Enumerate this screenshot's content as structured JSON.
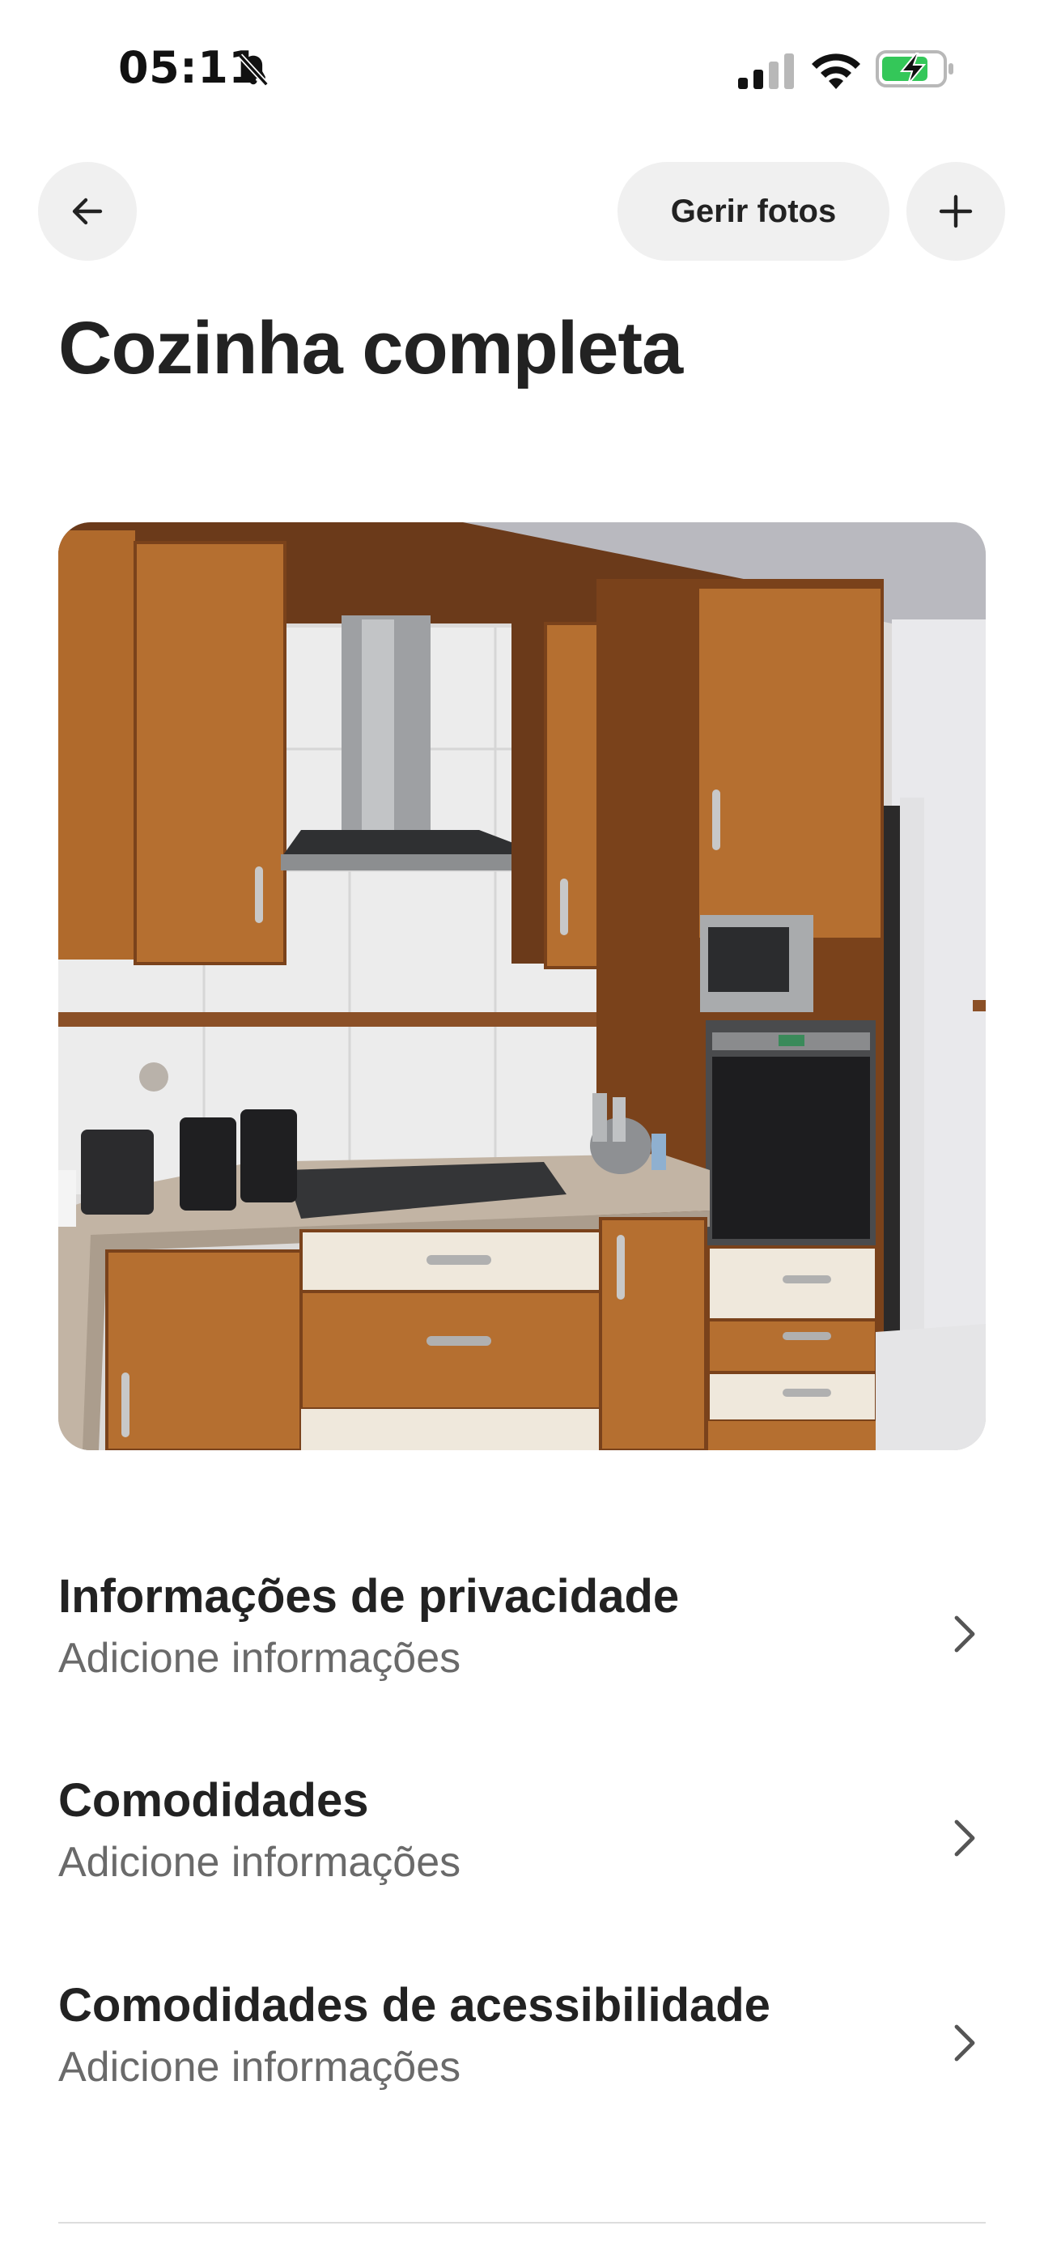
{
  "status_bar": {
    "time": "05:11"
  },
  "header": {
    "manage_photos_label": "Gerir fotos",
    "title": "Cozinha completa"
  },
  "sections": [
    {
      "title": "Informações de privacidade",
      "subtitle": "Adicione informações"
    },
    {
      "title": "Comodidades",
      "subtitle": "Adicione informações"
    },
    {
      "title": "Comodidades de acessibilidade",
      "subtitle": "Adicione informações"
    }
  ],
  "icons": {
    "back": "arrow-left-icon",
    "add": "plus-icon",
    "chevron": "chevron-right-icon",
    "bell": "bell-slash-icon"
  },
  "colors": {
    "text_primary": "#222222",
    "text_secondary": "#6a6a6a",
    "button_bg": "#f0f0f0",
    "battery_green": "#34c759"
  }
}
